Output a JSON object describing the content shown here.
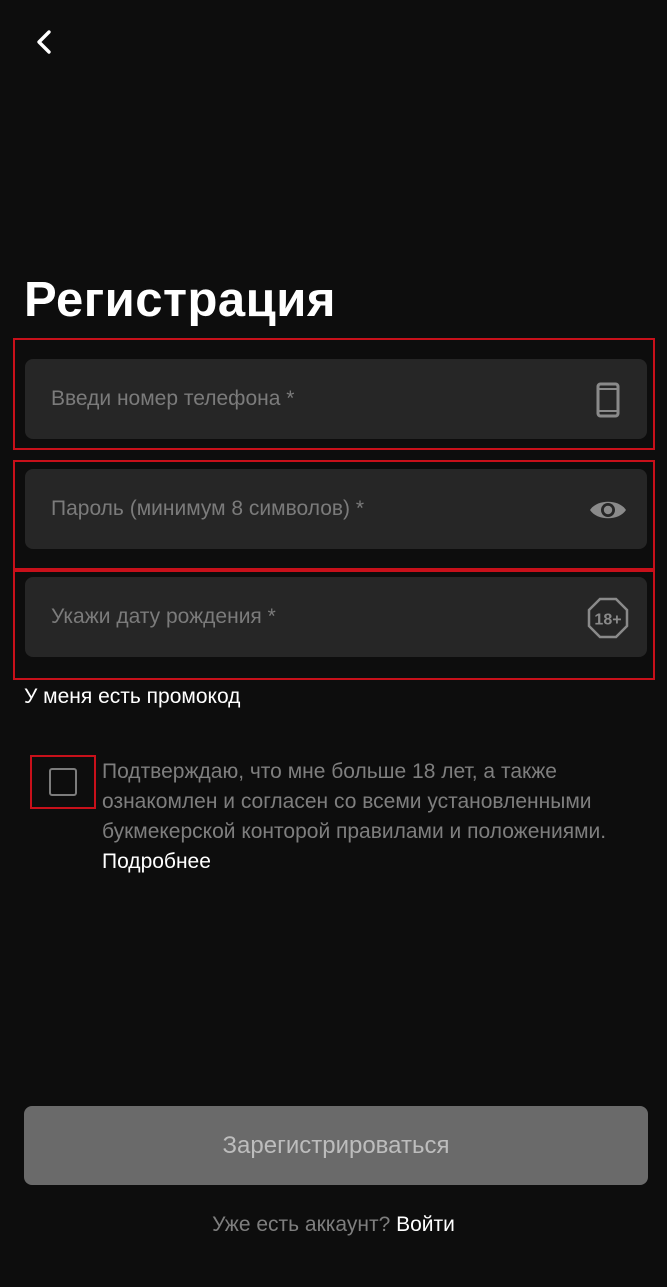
{
  "header": {
    "back_icon": "chevron-left-icon"
  },
  "title": "Регистрация",
  "form": {
    "phone": {
      "value": "",
      "placeholder": "Введи номер телефона *",
      "icon": "smartphone-icon"
    },
    "password": {
      "value": "",
      "placeholder": "Пароль (минимум 8 символов) *",
      "icon": "eye-icon"
    },
    "birthdate": {
      "value": "",
      "placeholder": "Укажи дату рождения *",
      "icon": "age-18-plus-icon",
      "icon_text": "18+"
    },
    "promo_label": "У меня есть промокод"
  },
  "agreement": {
    "checked": false,
    "text": "Подтверждаю, что мне больше 18 лет, а также ознакомлен и согласен со всеми установленными букмекерской конторой правилами и положениями.",
    "more_link": "Подробнее"
  },
  "actions": {
    "register_label": "Зарегистрироваться",
    "login_prompt": "Уже есть аккаунт?",
    "login_link": "Войти"
  },
  "colors": {
    "background": "#0d0d0d",
    "field_background": "#262626",
    "highlight_border": "#c8101a",
    "button_disabled": "#6a6a6a",
    "muted_text": "#7e7e7e"
  }
}
